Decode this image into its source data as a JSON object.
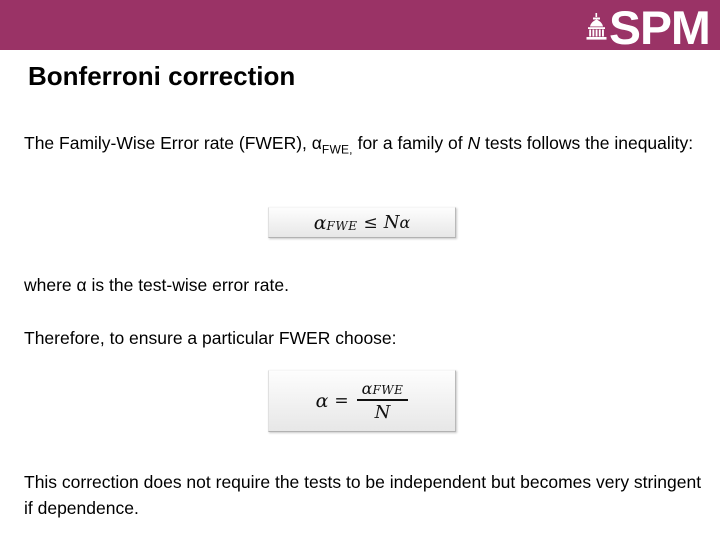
{
  "theme": {
    "header_color": "#9A3366",
    "page_background": "#FFFFFF",
    "text_color": "#000000"
  },
  "header": {
    "logo_text": "SPM",
    "logo_crest_icon": "institution-crest-icon"
  },
  "slide": {
    "title": "Bonferroni correction",
    "paragraphs": {
      "intro": {
        "part1": "The Family-Wise Error rate (FWER), ",
        "alpha": "α",
        "alpha_subscript": "FWE,",
        "part2": " for  a family of ",
        "var_n": "N",
        "part3": " tests follows the inequality:"
      },
      "where": "where α is the test-wise error rate.",
      "choose": "Therefore, to ensure a particular FWER choose:",
      "note": "This correction does not require the tests to be independent but becomes very stringent if dependence."
    },
    "equations": [
      {
        "name": "fwer-inequality",
        "latex": "\\alpha_{FWE} \\le N\\alpha",
        "plain": "α_FWE ≤ Nα",
        "alpha": "α",
        "subscript": "FWE",
        "relation": "≤",
        "var_n": "N",
        "alpha2": "α"
      },
      {
        "name": "alpha-definition",
        "latex": "\\alpha = \\frac{\\alpha_{FWE}}{N}",
        "plain": "α = α_FWE / N",
        "alpha": "α",
        "relation": "=",
        "numerator_alpha": "α",
        "numerator_subscript": "FWE",
        "denominator": "N"
      }
    ]
  }
}
